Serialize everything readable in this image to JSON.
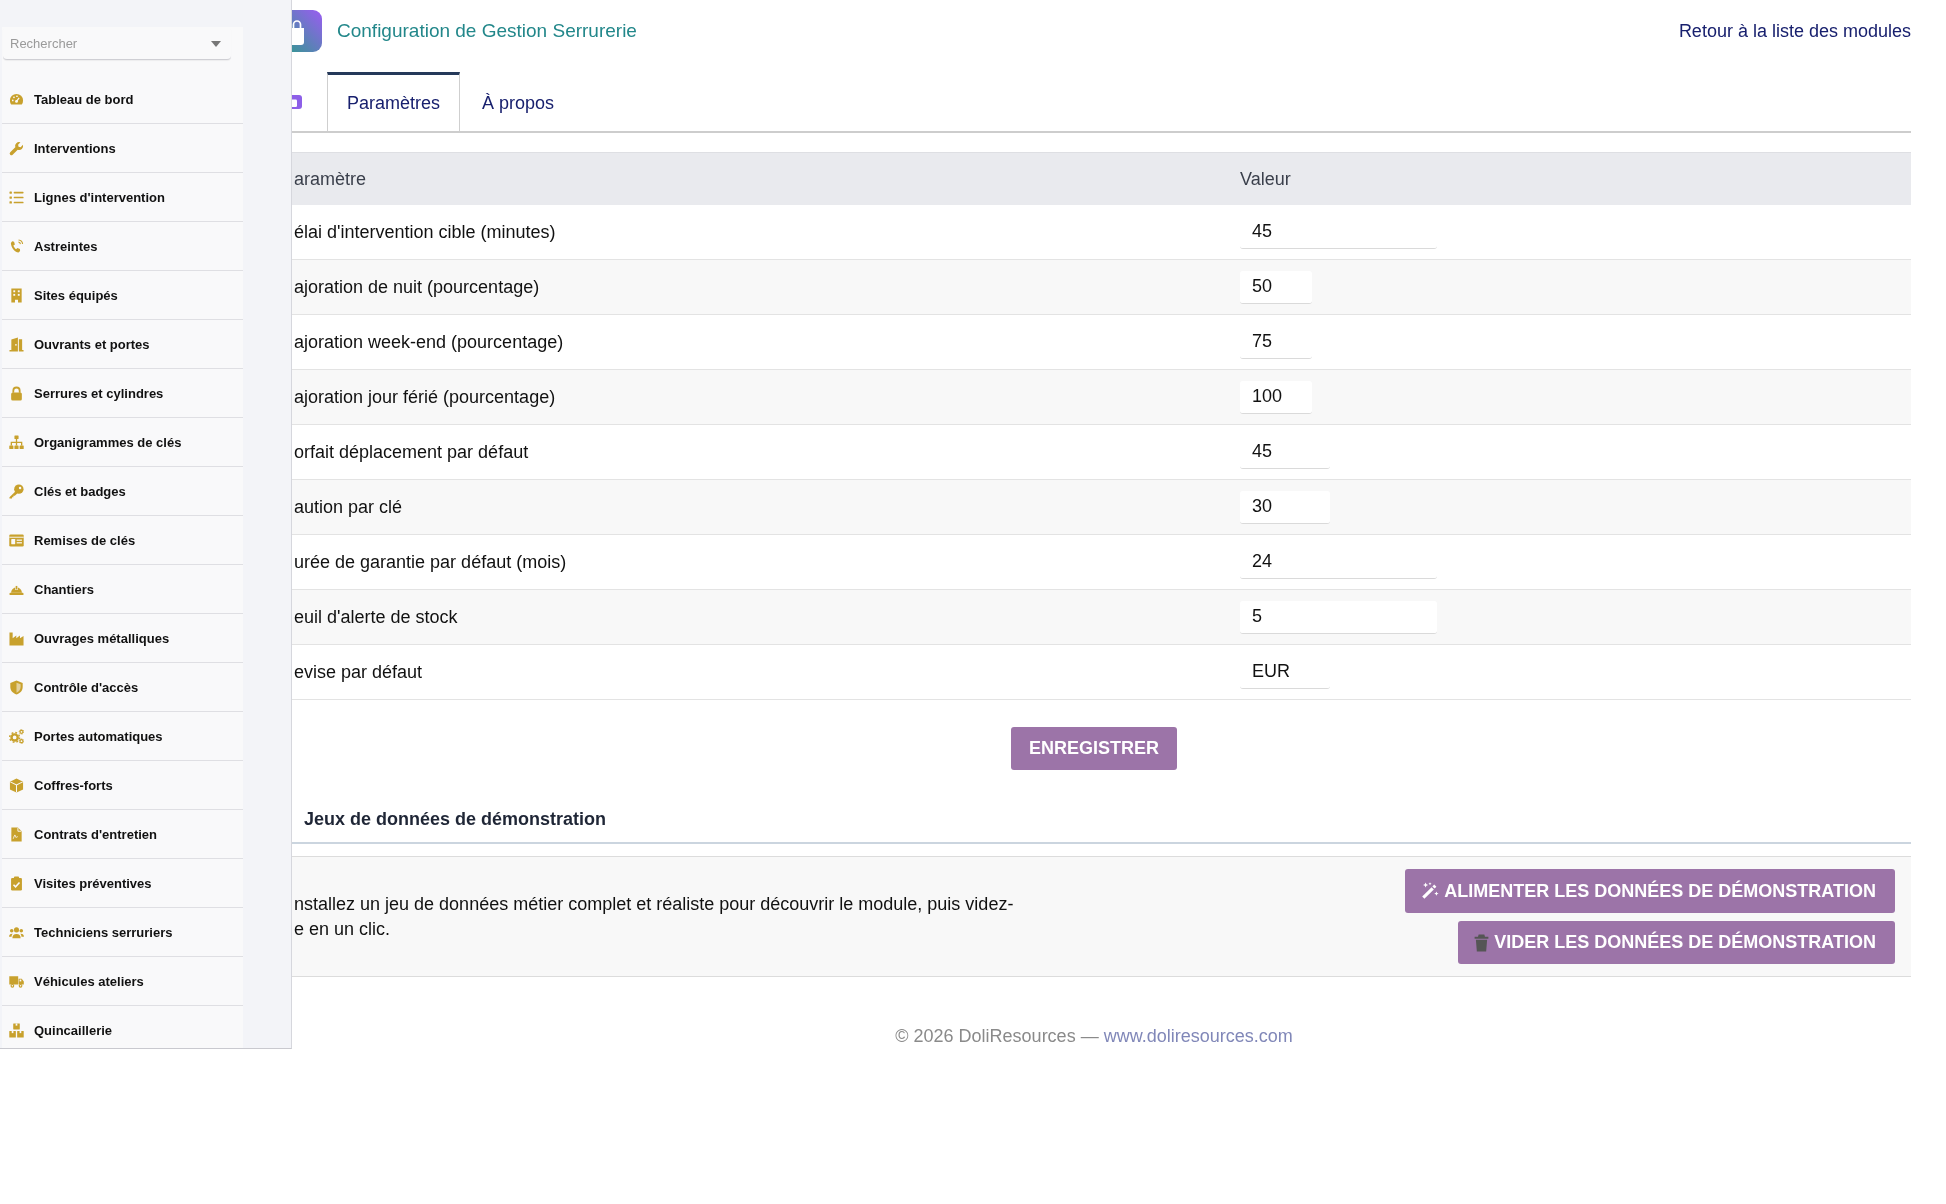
{
  "sidebar": {
    "search": {
      "placeholder": "Rechercher"
    },
    "items": [
      "Tableau de bord",
      "Interventions",
      "Lignes d'intervention",
      "Astreintes",
      "Sites équipés",
      "Ouvrants et portes",
      "Serrures et cylindres",
      "Organigrammes de clés",
      "Clés et badges",
      "Remises de clés",
      "Chantiers",
      "Ouvrages métalliques",
      "Contrôle d'accès",
      "Portes automatiques",
      "Coffres-forts",
      "Contrats d'entretien",
      "Visites préventives",
      "Techniciens serruriers",
      "Véhicules ateliers",
      "Quincaillerie"
    ]
  },
  "header": {
    "title": "Configuration de Gestion Serrurerie",
    "back_link": "Retour à la liste des modules"
  },
  "tabs": [
    {
      "label": "Paramètres",
      "selected": true
    },
    {
      "label": "À propos",
      "selected": false
    }
  ],
  "table": {
    "columns": [
      "aramètre",
      "Valeur"
    ],
    "rows": [
      {
        "label": "élai d'intervention cible (minutes)",
        "value": "45"
      },
      {
        "label": "ajoration de nuit (pourcentage)",
        "value": "50"
      },
      {
        "label": "ajoration week-end (pourcentage)",
        "value": "75"
      },
      {
        "label": "ajoration jour férié (pourcentage)",
        "value": "100"
      },
      {
        "label": "orfait déplacement par défaut",
        "value": "45"
      },
      {
        "label": "aution par clé",
        "value": "30"
      },
      {
        "label": "urée de garantie par défaut (mois)",
        "value": "24"
      },
      {
        "label": "euil d'alerte de stock",
        "value": "5"
      },
      {
        "label": "evise par défaut",
        "value": "EUR"
      }
    ]
  },
  "save_button": "ENREGISTRER",
  "demo": {
    "title": "Jeux de données de démonstration",
    "description": "nstallez un jeu de données métier complet et réaliste pour découvrir le module, puis videz-\ne en un clic.",
    "buttons": [
      "ALIMENTER LES DONNÉES DE DÉMONSTRATION",
      "VIDER LES DONNÉES DE DÉMONSTRATION"
    ]
  },
  "footer": {
    "text": "© 2026 DoliResources —",
    "link": "www.doliresources.com"
  }
}
